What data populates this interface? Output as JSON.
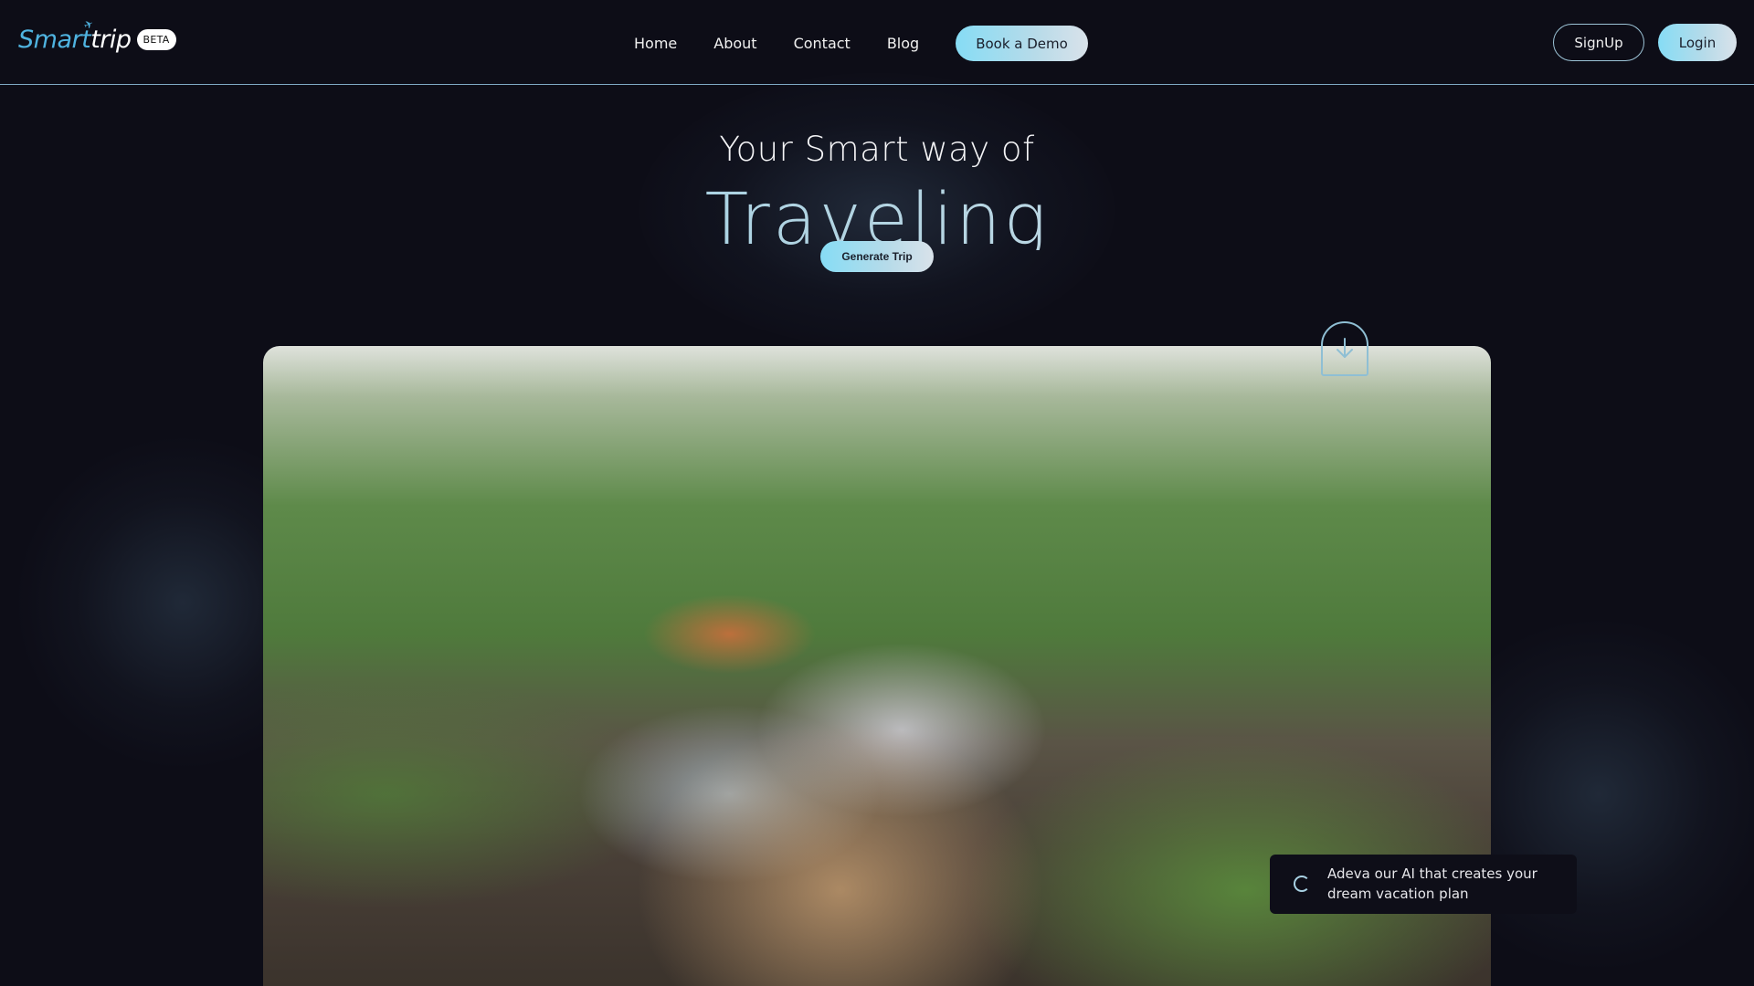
{
  "header": {
    "logo": {
      "part1": "Smart",
      "part2": "rip",
      "badge": "BETA",
      "icon": "airplane-icon"
    },
    "nav": [
      {
        "label": "Home"
      },
      {
        "label": "About"
      },
      {
        "label": "Contact"
      },
      {
        "label": "Blog"
      }
    ],
    "demo_button": "Book a Demo",
    "signup_button": "SignUp",
    "login_button": "Login"
  },
  "hero": {
    "subtitle": "Your Smart way of",
    "title": "Traveling",
    "generate_button": "Generate Trip",
    "scroll_icon": "arrow-down-icon"
  },
  "image": {
    "alt": "Woman carrying baby on her back tending plants in a green forest field"
  },
  "ai_card": {
    "icon": "spinner-icon",
    "text": "Adeva our AI that creates your dream vacation plan"
  },
  "colors": {
    "background": "#0d0d17",
    "accent": "#86dcf5",
    "logo_blue": "#4fb3e0"
  }
}
